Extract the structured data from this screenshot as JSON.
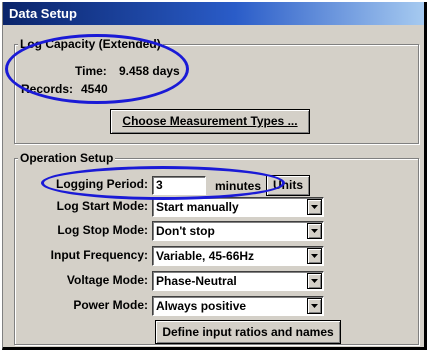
{
  "window": {
    "title": "Data Setup"
  },
  "log_capacity": {
    "legend": "Log Capacity (Extended)",
    "time_label": "Time:",
    "time_value": "9.458 days",
    "records_label": "Records:",
    "records_value": "4540",
    "choose_button": "Choose Measurement Types ..."
  },
  "operation_setup": {
    "legend": "Operation Setup",
    "logging_period": {
      "label": "Logging Period:",
      "value": "3",
      "unit": "minutes",
      "units_button": "Units"
    },
    "log_start_mode": {
      "label": "Log Start Mode:",
      "value": "Start manually"
    },
    "log_stop_mode": {
      "label": "Log Stop Mode:",
      "value": "Don't stop"
    },
    "input_frequency": {
      "label": "Input Frequency:",
      "value": "Variable, 45-66Hz"
    },
    "voltage_mode": {
      "label": "Voltage Mode:",
      "value": "Phase-Neutral"
    },
    "power_mode": {
      "label": "Power Mode:",
      "value": "Always positive"
    },
    "define_button": "Define input ratios and names"
  },
  "colors": {
    "title_bar": "#0a246a",
    "window_bg": "#d4d0c8",
    "highlight_oval": "#1a1ad6"
  },
  "icons": {
    "dropdown": "chevron-down-icon"
  }
}
